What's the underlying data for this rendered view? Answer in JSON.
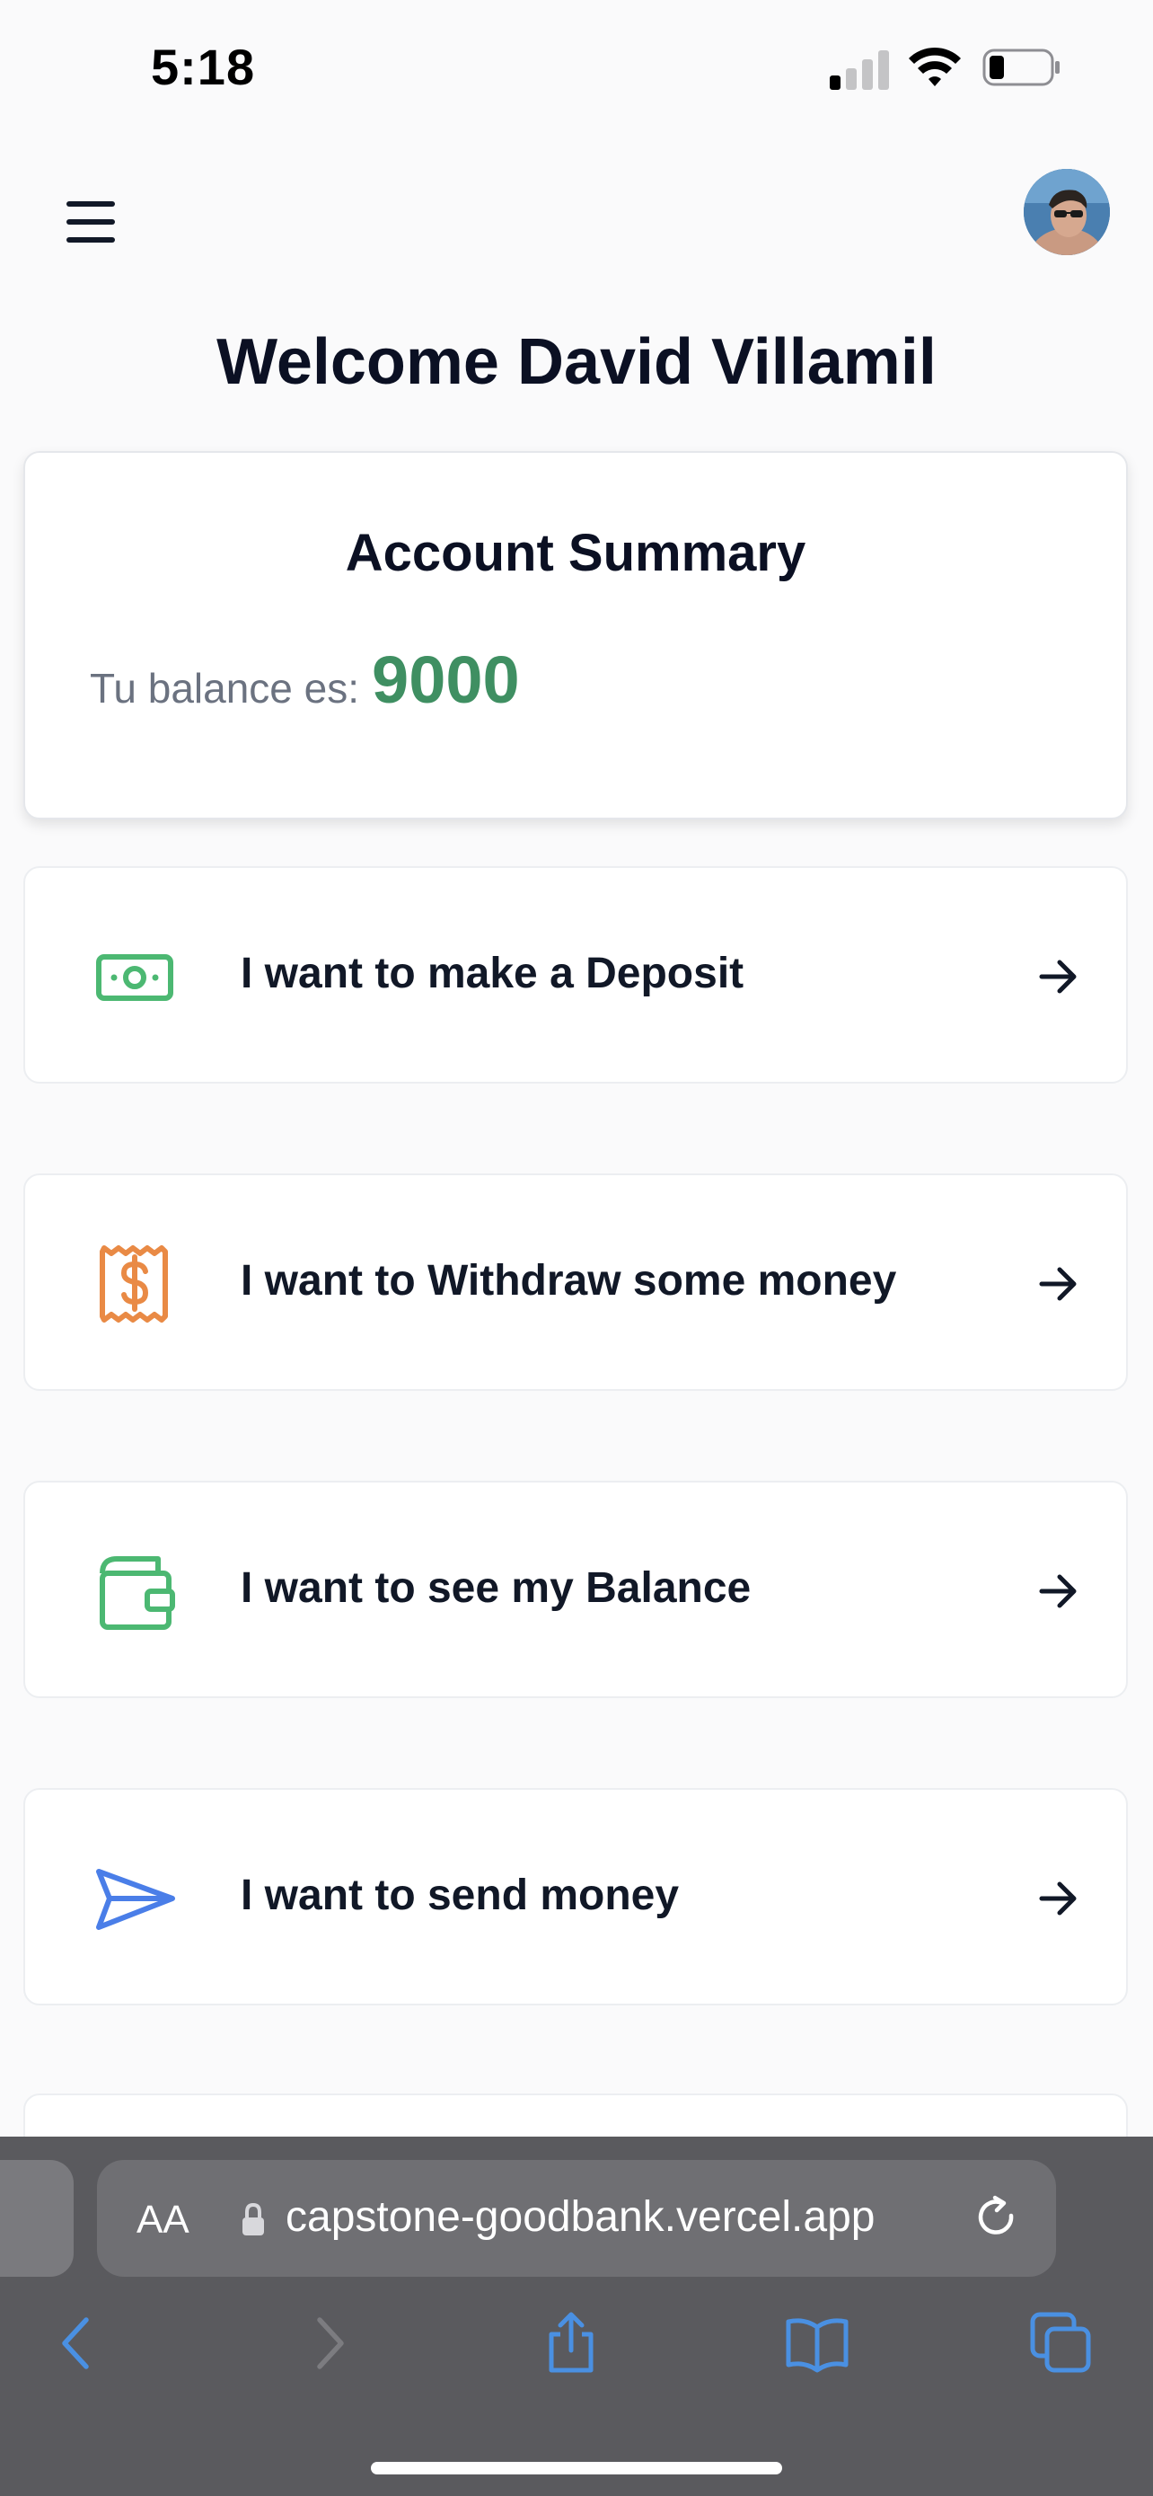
{
  "status_bar": {
    "time": "5:18"
  },
  "header": {
    "welcome": "Welcome David Villamil"
  },
  "summary": {
    "title": "Account Summary",
    "balance_label": "Tu balance es:",
    "balance_value": "9000"
  },
  "actions": [
    {
      "label": "I want to make a Deposit",
      "icon": "cash-icon",
      "color": "#4cb872"
    },
    {
      "label": "I want to Withdraw some money",
      "icon": "receipt-dollar-icon",
      "color": "#e98a45"
    },
    {
      "label": "I want to see my Balance",
      "icon": "wallet-icon",
      "color": "#4cb872"
    },
    {
      "label": "I want to send money",
      "icon": "paper-plane-icon",
      "color": "#4a7ee8"
    }
  ],
  "browser": {
    "text_size_label": "AA",
    "url": "capstone-goodbank.vercel.app"
  },
  "colors": {
    "balance": "#3f8f62",
    "safari_accent": "#4a90e2"
  }
}
